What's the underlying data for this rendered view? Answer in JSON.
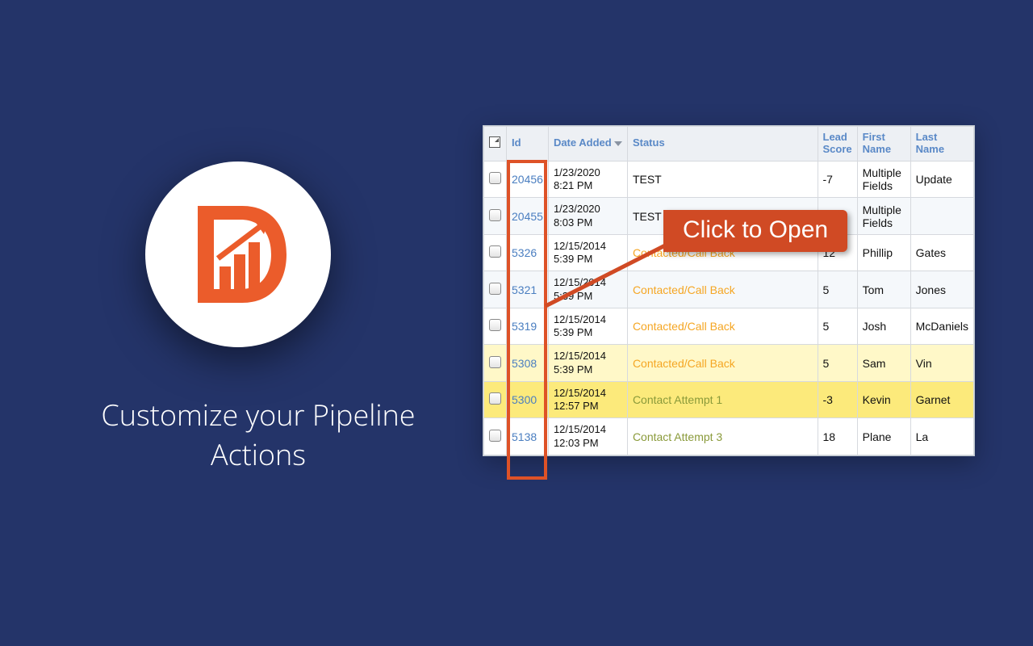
{
  "tagline": "Customize your Pipeline Actions",
  "callout": "Click to Open",
  "columns": {
    "id": "Id",
    "date": "Date Added",
    "status": "Status",
    "lead": "Lead Score",
    "first": "First Name",
    "last": "Last Name"
  },
  "rows": [
    {
      "id": "20456",
      "date": "1/23/2020 8:21 PM",
      "status": "TEST",
      "statusClass": "",
      "lead": "-7",
      "first": "Multiple Fields",
      "last": "Update",
      "rowClass": ""
    },
    {
      "id": "20455",
      "date": "1/23/2020 8:03 PM",
      "status": "TEST",
      "statusClass": "",
      "lead": "",
      "first": "Multiple Fields",
      "last": "",
      "rowClass": "row-blue"
    },
    {
      "id": "5326",
      "date": "12/15/2014 5:39 PM",
      "status": "Contacted/Call Back",
      "statusClass": "status-orange",
      "lead": "12",
      "first": "Phillip",
      "last": "Gates",
      "rowClass": ""
    },
    {
      "id": "5321",
      "date": "12/15/2014 5:39 PM",
      "status": "Contacted/Call Back",
      "statusClass": "status-orange",
      "lead": "5",
      "first": "Tom",
      "last": "Jones",
      "rowClass": "row-blue"
    },
    {
      "id": "5319",
      "date": "12/15/2014 5:39 PM",
      "status": "Contacted/Call Back",
      "statusClass": "status-orange",
      "lead": "5",
      "first": "Josh",
      "last": "McDaniels",
      "rowClass": ""
    },
    {
      "id": "5308",
      "date": "12/15/2014 5:39 PM",
      "status": "Contacted/Call Back",
      "statusClass": "status-orange",
      "lead": "5",
      "first": "Sam",
      "last": "Vin",
      "rowClass": "row-lit"
    },
    {
      "id": "5300",
      "date": "12/15/2014 12:57 PM",
      "status": "Contact Attempt 1",
      "statusClass": "status-olive",
      "lead": "-3",
      "first": "Kevin",
      "last": "Garnet",
      "rowClass": "row-yellow"
    },
    {
      "id": "5138",
      "date": "12/15/2014 12:03 PM",
      "status": "Contact Attempt 3",
      "statusClass": "status-olive",
      "lead": "18",
      "first": "Plane",
      "last": "La",
      "rowClass": ""
    }
  ]
}
